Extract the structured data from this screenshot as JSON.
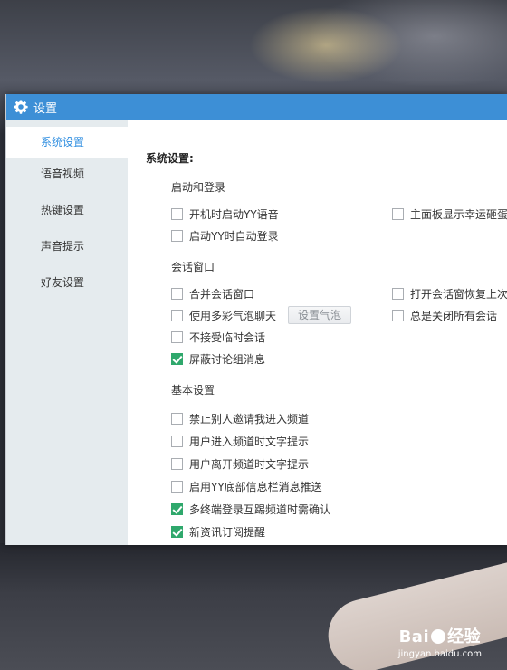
{
  "window": {
    "title": "设置"
  },
  "sidebar": {
    "items": [
      {
        "label": "系统设置",
        "active": true
      },
      {
        "label": "语音视频",
        "active": false
      },
      {
        "label": "热键设置",
        "active": false
      },
      {
        "label": "声音提示",
        "active": false
      },
      {
        "label": "好友设置",
        "active": false
      }
    ]
  },
  "content": {
    "section_title": "系统设置:",
    "groups": [
      {
        "title": "启动和登录",
        "options": [
          {
            "label": "开机时启动YY语音",
            "checked": false
          },
          {
            "label": "启动YY时自动登录",
            "checked": false
          },
          {
            "label": "主面板显示幸运砸蛋",
            "checked": false
          }
        ]
      },
      {
        "title": "会话窗口",
        "options": [
          {
            "label": "合并会话窗口",
            "checked": false
          },
          {
            "label": "使用多彩气泡聊天",
            "checked": false
          },
          {
            "label": "不接受临时会话",
            "checked": false
          },
          {
            "label": "屏蔽讨论组消息",
            "checked": true
          },
          {
            "label": "打开会话窗恢复上次",
            "checked": false
          },
          {
            "label": "总是关闭所有会话",
            "checked": false
          }
        ],
        "bubble_button": "设置气泡"
      },
      {
        "title": "基本设置",
        "options": [
          {
            "label": "禁止别人邀请我进入频道",
            "checked": false
          },
          {
            "label": "用户进入频道时文字提示",
            "checked": false
          },
          {
            "label": "用户离开频道时文字提示",
            "checked": false
          },
          {
            "label": "启用YY底部信息栏消息推送",
            "checked": false
          },
          {
            "label": "多终端登录互踢频道时需确认",
            "checked": true
          },
          {
            "label": "新资讯订阅提醒",
            "checked": true
          }
        ]
      }
    ]
  },
  "watermark": {
    "brand_left": "Bai",
    "brand_right": "经验",
    "site": "jingyan.baidu.com"
  },
  "colors": {
    "titlebar": "#3d8fd6",
    "active_nav": "#2f8ee0",
    "checked": "#2fa86c",
    "sidebar_bg": "#e5ebee"
  }
}
